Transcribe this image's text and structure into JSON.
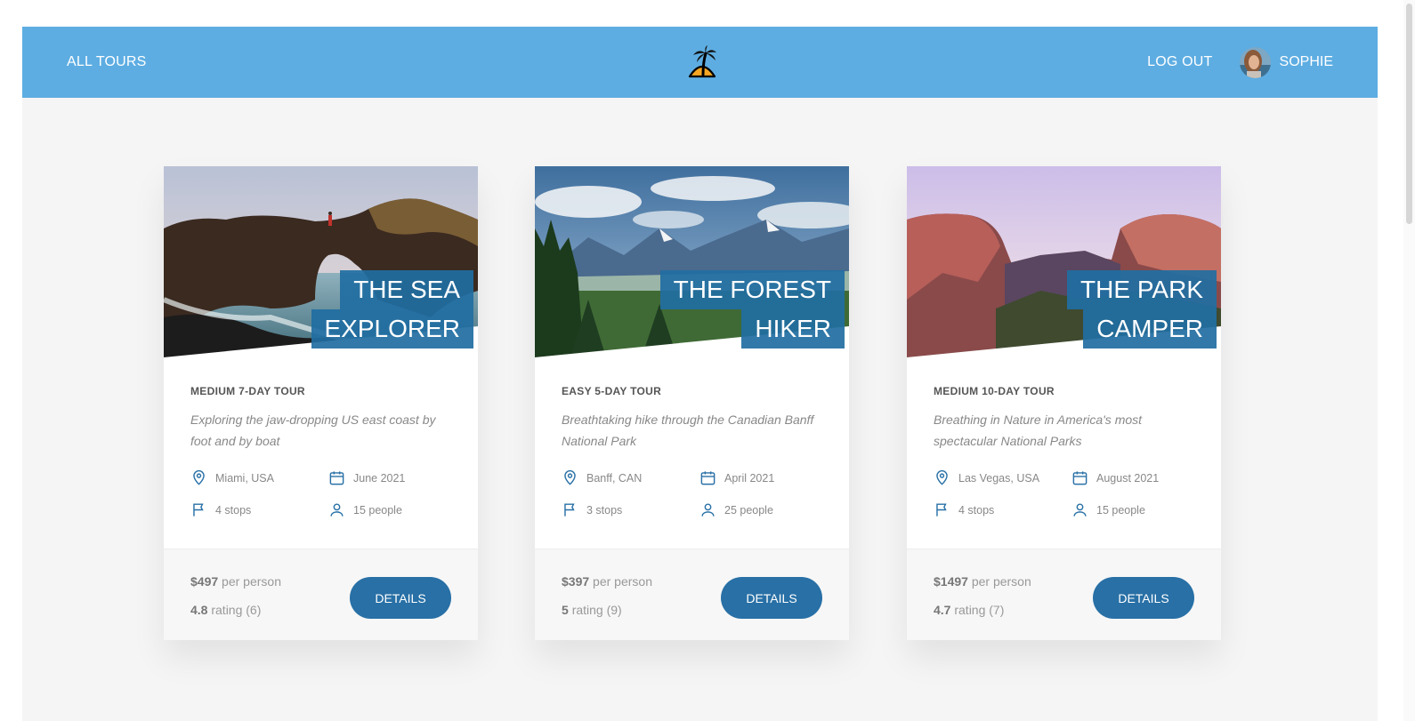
{
  "header": {
    "all_tours": "ALL TOURS",
    "logout": "LOG OUT",
    "user_name": "SOPHIE",
    "logo_icon": "palm-island-icon"
  },
  "colors": {
    "header": "#5dade2",
    "accent": "#2870a6",
    "background": "#f5f5f5"
  },
  "tours": [
    {
      "name_line1": "THE SEA",
      "name_line2": "EXPLORER",
      "subtitle": "MEDIUM 7-DAY TOUR",
      "summary": "Exploring the jaw-dropping US east coast by foot and by boat",
      "location": "Miami, USA",
      "date": "June 2021",
      "stops": "4 stops",
      "people": "15 people",
      "price": "$497",
      "price_suffix": "per person",
      "rating": "4.8",
      "rating_label": "rating (6)",
      "button": "DETAILS"
    },
    {
      "name_line1": "THE FOREST",
      "name_line2": "HIKER",
      "subtitle": "EASY 5-DAY TOUR",
      "summary": "Breathtaking hike through the Canadian Banff National Park",
      "location": "Banff, CAN",
      "date": "April 2021",
      "stops": "3 stops",
      "people": "25 people",
      "price": "$397",
      "price_suffix": "per person",
      "rating": "5",
      "rating_label": "rating (9)",
      "button": "DETAILS"
    },
    {
      "name_line1": "THE PARK",
      "name_line2": "CAMPER",
      "subtitle": "MEDIUM 10-DAY TOUR",
      "summary": "Breathing in Nature in America's most spectacular National Parks",
      "location": "Las Vegas, USA",
      "date": "August 2021",
      "stops": "4 stops",
      "people": "15 people",
      "price": "$1497",
      "price_suffix": "per person",
      "rating": "4.7",
      "rating_label": "rating (7)",
      "button": "DETAILS"
    }
  ]
}
